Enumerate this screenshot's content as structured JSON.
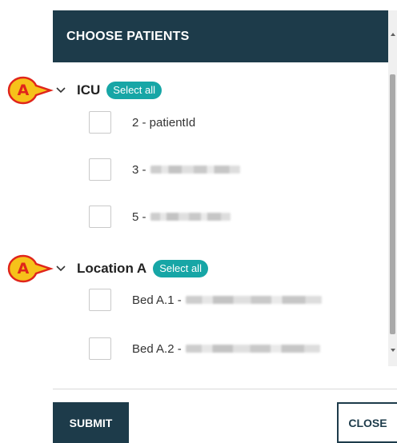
{
  "dialog": {
    "title": "CHOOSE PATIENTS"
  },
  "groups": [
    {
      "name": "ICU",
      "select_all_label": "Select all",
      "patients": [
        {
          "label": "2 - patientId",
          "redacted": false
        },
        {
          "label": "3 -",
          "redacted": true
        },
        {
          "label": "5 -",
          "redacted": true
        }
      ]
    },
    {
      "name": "Location A",
      "select_all_label": "Select all",
      "patients": [
        {
          "label": "Bed A.1 -",
          "redacted": true
        },
        {
          "label": "Bed A.2 -",
          "redacted": true
        }
      ]
    }
  ],
  "footer": {
    "submit_label": "SUBMIT",
    "close_label": "CLOSE"
  },
  "callouts": [
    {
      "letter": "A",
      "target": "icu-collapse-chevron"
    },
    {
      "letter": "A",
      "target": "location-a-collapse-chevron"
    }
  ],
  "icons": {
    "chevron": "chevron-down-icon",
    "callout": "callout-arrow-icon"
  },
  "colors": {
    "header_bg": "#1d3b4a",
    "select_all_bg": "#17a6a6",
    "callout_fill": "#f6c21a",
    "callout_letter": "#e0251b"
  }
}
